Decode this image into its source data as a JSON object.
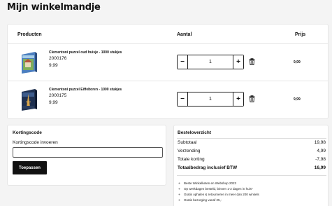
{
  "page": {
    "title": "Mijn winkelmandje"
  },
  "cart": {
    "headers": {
      "products": "Producten",
      "quantity": "Aantal",
      "price": "Prijs"
    },
    "items": [
      {
        "name": "Clementoni puzzel oud huisje - 1000 stukjes",
        "sku": "2000176",
        "unit_price": "9,99",
        "quantity": "1",
        "total": "9,99",
        "thumb_icon": "puzzle-box-cottage"
      },
      {
        "name": "Clementoni puzzel Eiffeltoren - 1000 stukjes",
        "sku": "2000175",
        "unit_price": "9,99",
        "quantity": "1",
        "total": "9,99",
        "thumb_icon": "puzzle-box-eiffel-tower"
      }
    ],
    "stepper": {
      "minus": "−",
      "plus": "+"
    }
  },
  "discount": {
    "title": "Kortingscode",
    "label": "Kortingscode invoeren",
    "input_value": "",
    "button_label": "Toepassen"
  },
  "summary": {
    "title": "Besteloverzicht",
    "rows": [
      {
        "label": "Subtotaal",
        "value": "19,98"
      },
      {
        "label": "Verzending",
        "value": "4,99"
      },
      {
        "label": "Totale korting",
        "value": "-7,98"
      }
    ],
    "total": {
      "label": "Totaalbedrag inclusief BTW",
      "value": "16,99"
    },
    "usps": [
      "Beste Winkelketen en Webshop 2023",
      "Op werkdagen besteld, binnen 1-2 dagen in huis*",
      "Gratis ophalen & retourneren in meer dan 200 winkels",
      "Gratis bezorging vanaf 25,-"
    ]
  },
  "colors": {
    "accent": "#111111",
    "border": "#e6e6e6",
    "background": "#f4f4f4"
  }
}
